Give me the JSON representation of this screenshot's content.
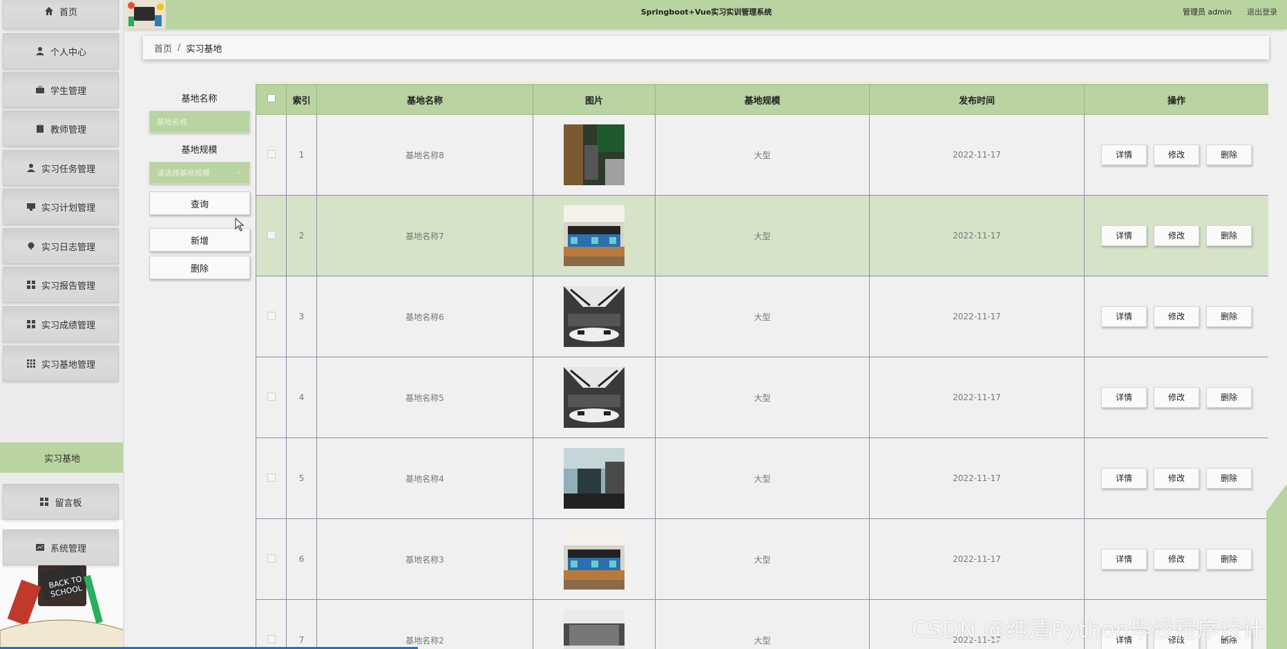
{
  "header": {
    "title": "Springboot+Vue实习实训管理系统",
    "user": "管理员 admin",
    "logout": "退出登录"
  },
  "sidebar": {
    "items": [
      {
        "label": "首页",
        "icon": "home-icon"
      },
      {
        "label": "个人中心",
        "icon": "user-icon"
      },
      {
        "label": "学生管理",
        "icon": "briefcase-icon"
      },
      {
        "label": "教师管理",
        "icon": "clipboard-icon"
      },
      {
        "label": "实习任务管理",
        "icon": "user-icon"
      },
      {
        "label": "实习计划管理",
        "icon": "monitor-icon"
      },
      {
        "label": "实习日志管理",
        "icon": "pin-icon"
      },
      {
        "label": "实习报告管理",
        "icon": "grid-icon"
      },
      {
        "label": "实习成绩管理",
        "icon": "grid-icon"
      },
      {
        "label": "实习基地管理",
        "icon": "grid9-icon"
      }
    ],
    "active": "实习基地",
    "after": [
      {
        "label": "留言板",
        "icon": "grid-icon"
      },
      {
        "label": "系统管理",
        "icon": "chart-icon"
      }
    ],
    "deco_text": "BACK TO SCHOOL"
  },
  "breadcrumb": {
    "home": "首页",
    "separator": "/",
    "current": "实习基地"
  },
  "filters": {
    "name_label": "基地名称",
    "name_placeholder": "基地名称",
    "scale_label": "基地规模",
    "scale_placeholder": "请选择基地规模",
    "query": "查询",
    "add": "新增",
    "delete": "删除"
  },
  "table": {
    "columns": [
      "索引",
      "基地名称",
      "图片",
      "基地规模",
      "发布时间",
      "操作"
    ],
    "actions": {
      "detail": "详情",
      "edit": "修改",
      "delete": "删除"
    },
    "rows": [
      {
        "index": "1",
        "name": "基地名称8",
        "scale": "大型",
        "date": "2022-11-17",
        "img": "office-photo"
      },
      {
        "index": "2",
        "name": "基地名称7",
        "scale": "大型",
        "date": "2022-11-17",
        "img": "computer-lab-photo"
      },
      {
        "index": "3",
        "name": "基地名称6",
        "scale": "大型",
        "date": "2022-11-17",
        "img": "meeting-hall-photo"
      },
      {
        "index": "4",
        "name": "基地名称5",
        "scale": "大型",
        "date": "2022-11-17",
        "img": "meeting-hall-photo"
      },
      {
        "index": "5",
        "name": "基地名称4",
        "scale": "大型",
        "date": "2022-11-17",
        "img": "office-room-photo"
      },
      {
        "index": "6",
        "name": "基地名称3",
        "scale": "大型",
        "date": "2022-11-17",
        "img": "computer-lab-photo"
      },
      {
        "index": "7",
        "name": "基地名称2",
        "scale": "大型",
        "date": "2022-11-17",
        "img": "open-office-photo"
      }
    ]
  },
  "watermark": "CSDN @纯清Python毕设程序设计"
}
